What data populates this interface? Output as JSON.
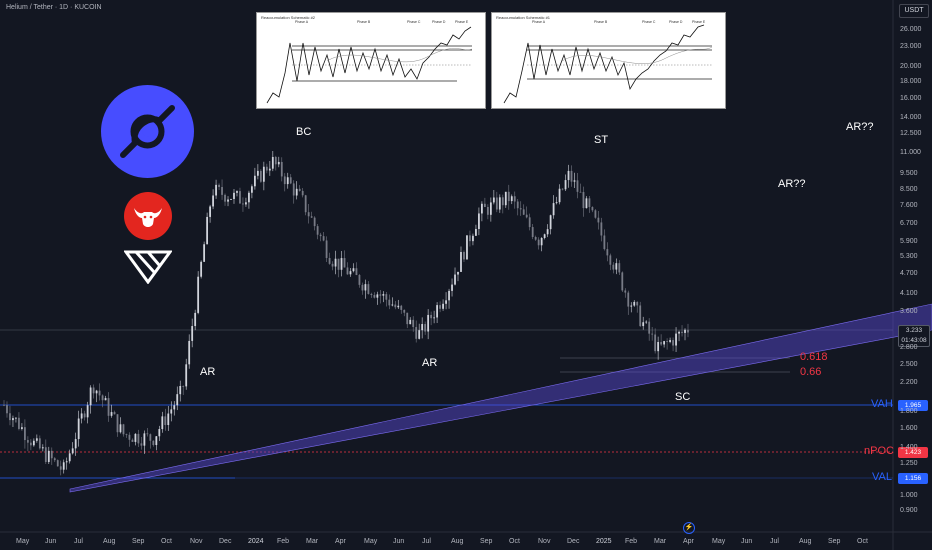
{
  "header": {
    "title": "Helium / Tether · 1D · KUCOIN",
    "currency": "USDT"
  },
  "insets": [
    {
      "caption": "Reaccumulation Schematic #2",
      "phases": [
        "Phase A",
        "Phase B",
        "Phase C",
        "Phase D",
        "Phase E"
      ]
    },
    {
      "caption": "Reaccumulation Schematic #1",
      "phases": [
        "Phase A",
        "Phase B",
        "Phase C",
        "Phase D",
        "Phase E"
      ]
    }
  ],
  "annotations": {
    "bc": "BC",
    "st": "ST",
    "ar_left": "AR",
    "ar_mid": "AR",
    "sc": "SC",
    "ar_q1": "AR??",
    "ar_q2": "AR??",
    "fib1": "0.618",
    "fib2": "0.66",
    "vah": "VAH",
    "npoc": "nPOC",
    "val": "VAL"
  },
  "price_badges": {
    "current": "3.233",
    "countdown": "01:43:08",
    "vah": "1.965",
    "npoc": "1.423",
    "val": "1.156"
  },
  "colors": {
    "background": "#131722",
    "candle_up": "#d1d4dc",
    "candle_down": "#787b86",
    "channel": "#5b4bdb",
    "vah_line": "#2962ff",
    "npoc_line": "#f23645",
    "fib": "#f23645",
    "helium_logo": "#474dff",
    "bull_logo": "#e3261f"
  },
  "chart_data": {
    "type": "candlestick",
    "title": "Helium / Tether · 1D · KUCOIN",
    "y_scale": "log",
    "ylim": [
      0.85,
      28
    ],
    "y_ticks": [
      "26.000",
      "23.000",
      "20.000",
      "18.000",
      "16.000",
      "14.000",
      "12.500",
      "11.000",
      "9.500",
      "8.500",
      "7.600",
      "6.700",
      "5.900",
      "5.300",
      "4.700",
      "4.100",
      "3.600",
      "2.800",
      "2.500",
      "2.200",
      "1.800",
      "1.600",
      "1.400",
      "1.250",
      "1.000",
      "0.900"
    ],
    "x_ticks": [
      "May",
      "Jun",
      "Jul",
      "Aug",
      "Sep",
      "Oct",
      "Nov",
      "Dec",
      "2024",
      "Feb",
      "Mar",
      "Apr",
      "May",
      "Jun",
      "Jul",
      "Aug",
      "Sep",
      "Oct",
      "Nov",
      "Dec",
      "2025",
      "Feb",
      "Mar",
      "Apr",
      "May",
      "Jun",
      "Jul",
      "Aug",
      "Sep",
      "Oct"
    ],
    "price_path": [
      {
        "t": "May",
        "close": 1.9
      },
      {
        "t": "Jun",
        "close": 1.45
      },
      {
        "t": "Jul",
        "close": 1.2
      },
      {
        "t": "Aug",
        "close": 2.2
      },
      {
        "t": "Sep",
        "close": 1.55
      },
      {
        "t": "Oct",
        "close": 1.5
      },
      {
        "t": "Nov",
        "close": 2.1
      },
      {
        "t": "Dec",
        "close": 8.5
      },
      {
        "t": "2024",
        "close": 8.0
      },
      {
        "t": "Feb",
        "close": 10.5
      },
      {
        "t": "Mar",
        "close": 8.0
      },
      {
        "t": "Apr",
        "close": 5.3
      },
      {
        "t": "May",
        "close": 4.5
      },
      {
        "t": "Jun",
        "close": 3.9
      },
      {
        "t": "Jul",
        "close": 3.1
      },
      {
        "t": "Aug",
        "close": 4.4
      },
      {
        "t": "Sep",
        "close": 7.3
      },
      {
        "t": "Oct",
        "close": 8.1
      },
      {
        "t": "Nov",
        "close": 6.0
      },
      {
        "t": "Dec",
        "close": 9.5
      },
      {
        "t": "2025",
        "close": 6.5
      },
      {
        "t": "Feb",
        "close": 4.0
      },
      {
        "t": "Mar",
        "close": 2.8
      },
      {
        "t": "Mar",
        "close": 3.233
      }
    ],
    "levels": {
      "vah": 1.965,
      "npoc": 1.423,
      "val": 1.156,
      "fib_0618": 2.6,
      "fib_066": 2.42
    },
    "current_price": 3.233
  }
}
